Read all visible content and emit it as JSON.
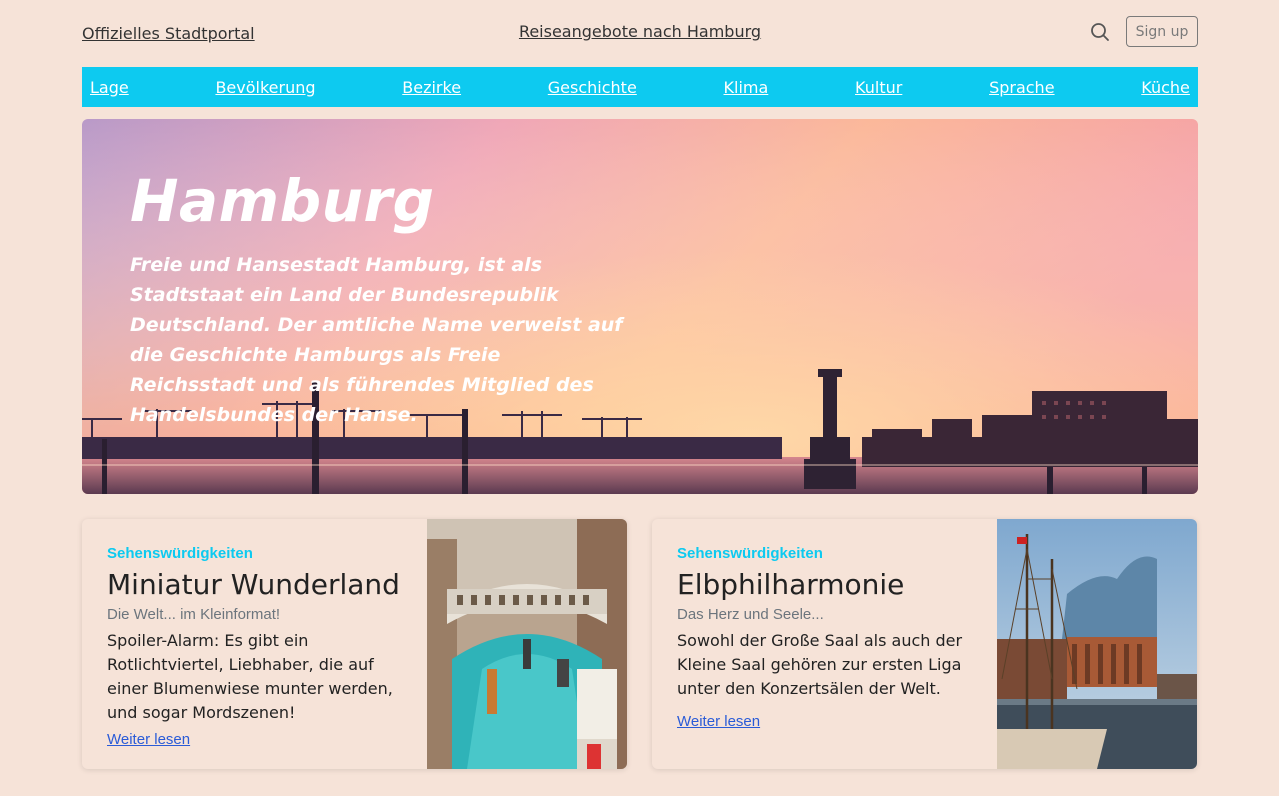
{
  "header": {
    "site_link": "Offizielles Stadtportal",
    "travel_link": "Reiseangebote nach Hamburg",
    "search_icon": "search-icon",
    "signup_label": "Sign up"
  },
  "nav": {
    "items": [
      "Lage",
      "Bevölkerung",
      "Bezirke",
      "Geschichte",
      "Klima",
      "Kultur",
      "Sprache",
      "Küche"
    ]
  },
  "hero": {
    "title": "Hamburg",
    "text": "Freie und Hansestadt Hamburg, ist als Stadtstaat ein Land der Bundesrepublik Deutschland. Der amtliche Name verweist auf die Geschichte Hamburgs als Freie Reichsstadt und als führendes Mitglied des Handelsbundes der Hanse."
  },
  "cards": [
    {
      "category": "Sehenswürdigkeiten",
      "title": "Miniatur Wunderland",
      "subtitle": "Die Welt... im Kleinformat!",
      "text": "Spoiler-Alarm: Es gibt ein Rotlichtviertel, Liebhaber, die auf einer Blumenwiese munter werden, und sogar Mordszenen!",
      "link": "Weiter lesen"
    },
    {
      "category": "Sehenswürdigkeiten",
      "title": "Elbphilharmonie",
      "subtitle": "Das Herz und Seele...",
      "text": "Sowohl der Große Saal als auch der Kleine Saal gehören zur ersten Liga unter den Konzertsälen der Welt.",
      "link": "Weiter lesen"
    }
  ],
  "colors": {
    "background": "#f6e3d8",
    "nav_bar": "#0dcaf0",
    "category_text": "#0dcaf0",
    "link": "#2a5bd7"
  }
}
